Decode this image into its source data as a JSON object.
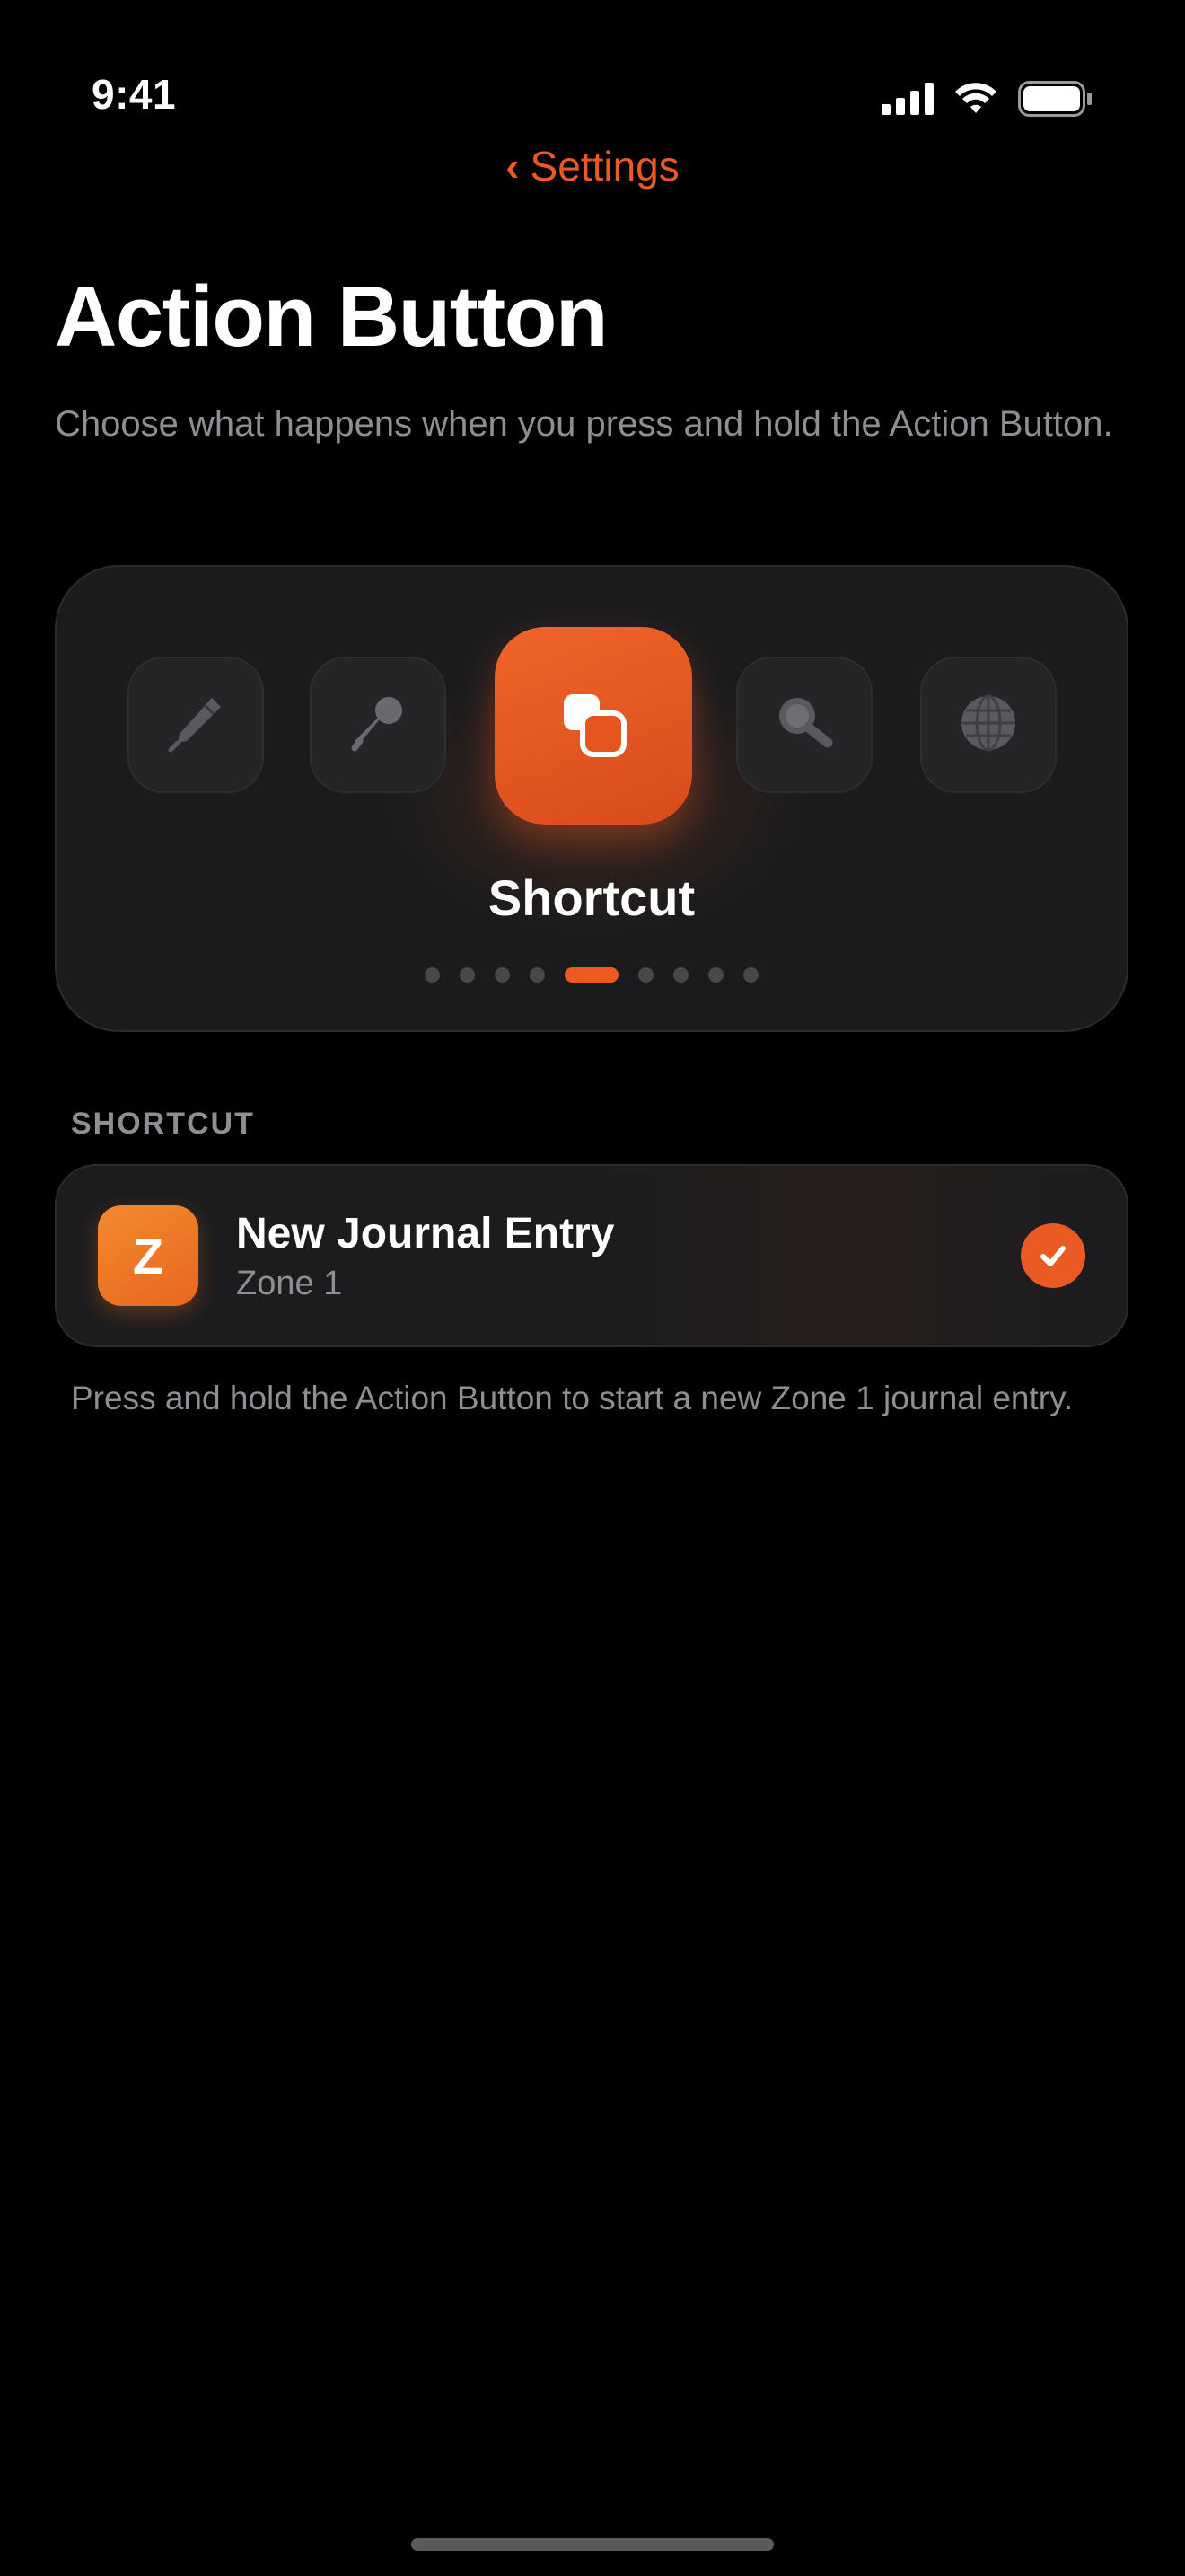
{
  "status_bar": {
    "time": "9:41"
  },
  "nav": {
    "back_label": "Settings",
    "back_chevron": "‹"
  },
  "page": {
    "title": "Action Button",
    "subtitle": "Choose what happens when you press and hold the Action Button."
  },
  "picker": {
    "actions": [
      {
        "icon": "pen-icon",
        "selected": false
      },
      {
        "icon": "microphone-icon",
        "selected": false
      },
      {
        "icon": "shortcut-icon",
        "selected": true
      },
      {
        "icon": "magnifier-icon",
        "selected": false
      },
      {
        "icon": "globe-icon",
        "selected": false
      }
    ],
    "selected_label": "Shortcut",
    "page_count": 9,
    "active_page_index": 4
  },
  "shortcut_section": {
    "header": "SHORTCUT",
    "item": {
      "app_icon_letter": "Z",
      "name": "New Journal Entry",
      "subtitle": "Zone 1",
      "selected": true
    },
    "footnote": "Press and hold the Action Button to start a new Zone 1 journal entry."
  },
  "colors": {
    "accent": "#ea5a22",
    "background": "#000000",
    "card": "#1c1c1e",
    "secondary_text": "#8e8e93"
  }
}
